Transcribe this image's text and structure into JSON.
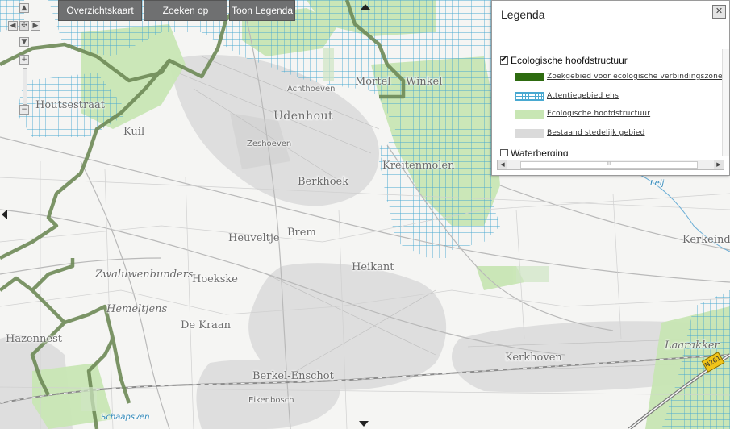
{
  "toolbar": {
    "overview": "Overzichtskaart",
    "search": "Zoeken op",
    "legend": "Toon Legenda"
  },
  "places": {
    "achthoeven": "Achthoeven",
    "mortel": "Mortel",
    "winkel": "Winkel",
    "houtsestraat": "Houtsestraat",
    "udenhout": "Udenhout",
    "kuil": "Kuil",
    "zeshoeven": "Zeshoeven",
    "kreitenmolen": "Kreitenmolen",
    "berkhoek": "Berkhoek",
    "leij": "Leij",
    "heuveltje": "Heuveltje",
    "brem": "Brem",
    "kerkeind": "Kerkeind",
    "heikant": "Heikant",
    "zwaluwenbunders": "Zwaluwenbunders",
    "hoekske": "Hoekske",
    "hemeltjens": "Hemeltjens",
    "de_kraan": "De Kraan",
    "hazennest": "Hazennest",
    "laarakker": "Laarakker",
    "kerkhoven": "Kerkhoven",
    "berkel_enschot": "Berkel-Enschot",
    "eikenbosch": "Eikenbosch",
    "schaapsven": "Schaapsven",
    "road_shield": "N261"
  },
  "legend": {
    "title": "Legenda",
    "close": "✕",
    "group1": "Ecologische hoofdstructuur",
    "items": [
      {
        "label": "Zoekgebied voor ecologische verbindingszone",
        "color": "#2e6b10"
      },
      {
        "label": "Attentiegebied ehs",
        "color": "#49a9d1"
      },
      {
        "label": "Ecologische hoofdstructuur",
        "color": "#c8e6b4"
      },
      {
        "label": "Bestaand stedelijk gebied",
        "color": "#dadada"
      }
    ],
    "group2": "Waterberging",
    "scroll_thumb": "III"
  },
  "colors": {
    "ehs": "#c8e6b4",
    "grid": "#49a9d1",
    "corridor": "#6e8a57",
    "urban": "#d7d7d7"
  }
}
